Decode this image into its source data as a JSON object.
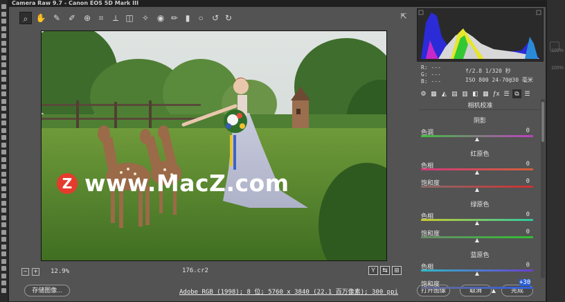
{
  "window": {
    "title": "Camera Raw 9.7 - Canon EOS 5D Mark III"
  },
  "toolbar": {
    "tools": [
      {
        "name": "zoom-tool",
        "glyph": "⌕",
        "active": true
      },
      {
        "name": "hand-tool",
        "glyph": "✋"
      },
      {
        "name": "white-balance-tool",
        "glyph": "✎"
      },
      {
        "name": "color-sampler-tool",
        "glyph": "✐"
      },
      {
        "name": "targeted-adjustment-tool",
        "glyph": "⊕"
      },
      {
        "name": "crop-tool",
        "glyph": "⌗"
      },
      {
        "name": "straighten-tool",
        "glyph": "⟂"
      },
      {
        "name": "transform-tool",
        "glyph": "◫"
      },
      {
        "name": "spot-removal-tool",
        "glyph": "✧"
      },
      {
        "name": "red-eye-tool",
        "glyph": "◉"
      },
      {
        "name": "adjustment-brush-tool",
        "glyph": "✏"
      },
      {
        "name": "graduated-filter-tool",
        "glyph": "▮"
      },
      {
        "name": "radial-filter-tool",
        "glyph": "○"
      },
      {
        "name": "rotate-left-tool",
        "glyph": "↺"
      },
      {
        "name": "rotate-right-tool",
        "glyph": "↻"
      }
    ],
    "export_glyph": "⇱"
  },
  "watermark": {
    "logo": "Z",
    "text": "www.MacZ.com"
  },
  "preview": {
    "zoom": "12.9%",
    "filename": "176.cr2",
    "zoom_minus": "−",
    "zoom_plus": "+"
  },
  "view_buttons": [
    "Y",
    "⇆",
    "⊞"
  ],
  "readout": {
    "r": "R:  ---",
    "g": "G:  ---",
    "b": "B:  ---",
    "exposure": "f/2.8   1/320 秒",
    "iso": "ISO 800   24-70@30 毫米"
  },
  "panel": {
    "title": "相机校准",
    "tab_glyphs": [
      "⚙",
      "▦",
      "◭",
      "▤",
      "▥",
      "◧",
      "▦",
      "ƒx",
      "☰",
      "⧉",
      "☰"
    ],
    "sections": [
      {
        "title": "阴影",
        "rows": [
          {
            "label": "色调",
            "value": "0",
            "level": 0,
            "gradient": "linear-gradient(90deg,#3fbf3f,#bf3fbf)"
          }
        ]
      },
      {
        "title": "红原色",
        "rows": [
          {
            "label": "色相",
            "value": "0",
            "level": 0,
            "gradient": "linear-gradient(90deg,#d23a7a,#d2603a)"
          },
          {
            "label": "饱和度",
            "value": "0",
            "level": 0,
            "gradient": "linear-gradient(90deg,#8a6a6a,#d03030)"
          }
        ]
      },
      {
        "title": "绿原色",
        "rows": [
          {
            "label": "色相",
            "value": "0",
            "level": 0,
            "gradient": "linear-gradient(90deg,#c8c830,#30c8a0)"
          },
          {
            "label": "饱和度",
            "value": "0",
            "level": 0,
            "gradient": "linear-gradient(90deg,#6a8a6a,#30c030)"
          }
        ]
      },
      {
        "title": "蓝原色",
        "rows": [
          {
            "label": "色相",
            "value": "0",
            "level": 0,
            "gradient": "linear-gradient(90deg,#30b8c8,#6a40d0)"
          },
          {
            "label": "饱和度",
            "value": "+30",
            "level": 30,
            "editing": true,
            "gradient": "linear-gradient(90deg,#6a6a8a,#3060e0)"
          }
        ]
      }
    ]
  },
  "footer": {
    "save_label": "存储图像...",
    "workflow": "Adobe RGB (1998); 8 位; 5760 x 3840 (22.1 百万像素); 300 ppi",
    "open_label": "打开图像",
    "cancel_label": "取消",
    "done_label": "完成"
  },
  "ps_right": {
    "pct1": "100%",
    "pct2": "100%"
  }
}
